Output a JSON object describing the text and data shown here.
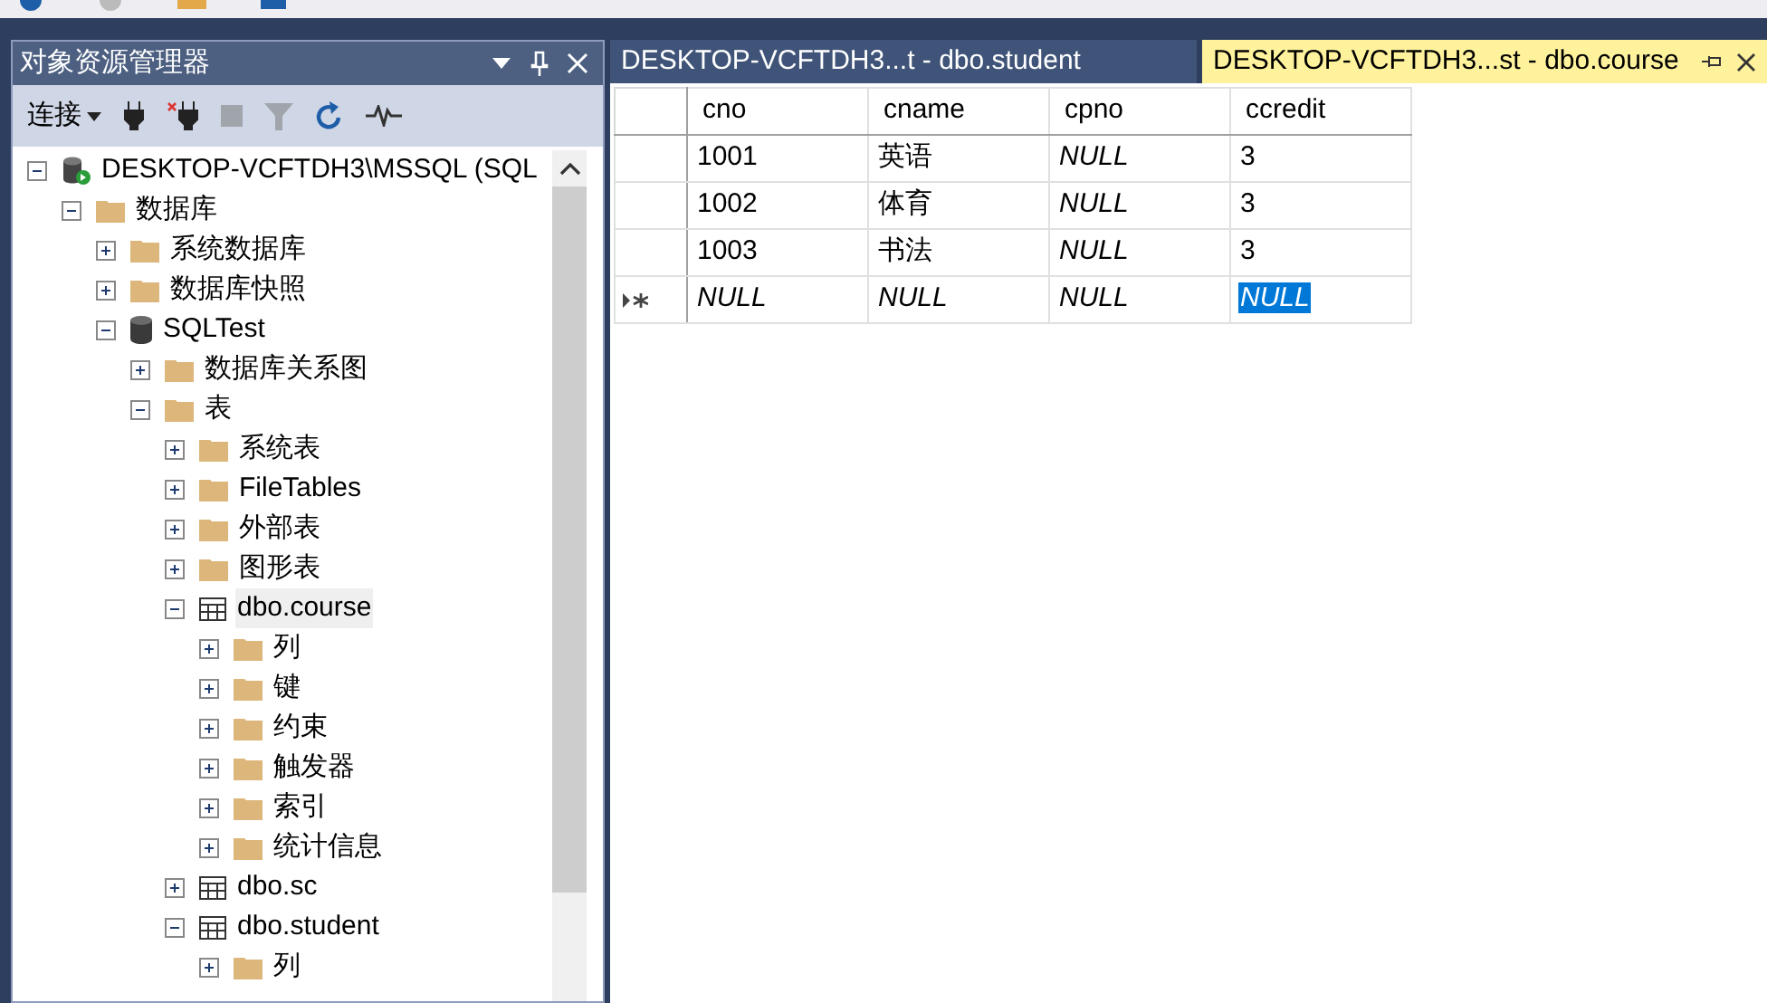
{
  "object_explorer": {
    "title": "对象资源管理器",
    "connect_label": "连接",
    "tree": [
      {
        "label": "DESKTOP-VCFTDH3\\MSSQL (SQL",
        "kind": "server",
        "expanded": true,
        "selected": false,
        "children": [
          {
            "label": "数据库",
            "kind": "folder",
            "expanded": true,
            "selected": false,
            "children": [
              {
                "label": "系统数据库",
                "kind": "folder",
                "expanded": false,
                "selected": false
              },
              {
                "label": "数据库快照",
                "kind": "folder",
                "expanded": false,
                "selected": false
              },
              {
                "label": "SQLTest",
                "kind": "database",
                "expanded": true,
                "selected": false,
                "children": [
                  {
                    "label": "数据库关系图",
                    "kind": "folder",
                    "expanded": false,
                    "selected": false
                  },
                  {
                    "label": "表",
                    "kind": "folder",
                    "expanded": true,
                    "selected": false,
                    "children": [
                      {
                        "label": "系统表",
                        "kind": "folder",
                        "expanded": false,
                        "selected": false
                      },
                      {
                        "label": "FileTables",
                        "kind": "folder",
                        "expanded": false,
                        "selected": false
                      },
                      {
                        "label": "外部表",
                        "kind": "folder",
                        "expanded": false,
                        "selected": false
                      },
                      {
                        "label": "图形表",
                        "kind": "folder",
                        "expanded": false,
                        "selected": false
                      },
                      {
                        "label": "dbo.course",
                        "kind": "table",
                        "expanded": true,
                        "selected": true,
                        "children": [
                          {
                            "label": "列",
                            "kind": "folder",
                            "expanded": false,
                            "selected": false
                          },
                          {
                            "label": "键",
                            "kind": "folder",
                            "expanded": false,
                            "selected": false
                          },
                          {
                            "label": "约束",
                            "kind": "folder",
                            "expanded": false,
                            "selected": false
                          },
                          {
                            "label": "触发器",
                            "kind": "folder",
                            "expanded": false,
                            "selected": false
                          },
                          {
                            "label": "索引",
                            "kind": "folder",
                            "expanded": false,
                            "selected": false
                          },
                          {
                            "label": "统计信息",
                            "kind": "folder",
                            "expanded": false,
                            "selected": false
                          }
                        ]
                      },
                      {
                        "label": "dbo.sc",
                        "kind": "table",
                        "expanded": false,
                        "selected": false
                      },
                      {
                        "label": "dbo.student",
                        "kind": "table",
                        "expanded": true,
                        "selected": false,
                        "children": [
                          {
                            "label": "列",
                            "kind": "folder",
                            "expanded": false,
                            "selected": false
                          }
                        ]
                      }
                    ]
                  }
                ]
              }
            ]
          }
        ]
      }
    ]
  },
  "tabs": [
    {
      "label": "DESKTOP-VCFTDH3...t - dbo.student",
      "selected": false
    },
    {
      "label": "DESKTOP-VCFTDH3...st - dbo.course",
      "selected": true
    }
  ],
  "grid": {
    "columns": [
      "cno",
      "cname",
      "cpno",
      "ccredit"
    ],
    "rows": [
      {
        "new_row": false,
        "cells": [
          {
            "value": "1001",
            "is_null": false,
            "selected": false
          },
          {
            "value": "英语",
            "is_null": false,
            "selected": false
          },
          {
            "value": "NULL",
            "is_null": true,
            "selected": false
          },
          {
            "value": "3",
            "is_null": false,
            "selected": false
          }
        ]
      },
      {
        "new_row": false,
        "cells": [
          {
            "value": "1002",
            "is_null": false,
            "selected": false
          },
          {
            "value": "体育",
            "is_null": false,
            "selected": false
          },
          {
            "value": "NULL",
            "is_null": true,
            "selected": false
          },
          {
            "value": "3",
            "is_null": false,
            "selected": false
          }
        ]
      },
      {
        "new_row": false,
        "cells": [
          {
            "value": "1003",
            "is_null": false,
            "selected": false
          },
          {
            "value": "书法",
            "is_null": false,
            "selected": false
          },
          {
            "value": "NULL",
            "is_null": true,
            "selected": false
          },
          {
            "value": "3",
            "is_null": false,
            "selected": false
          }
        ]
      },
      {
        "new_row": true,
        "cells": [
          {
            "value": "NULL",
            "is_null": true,
            "selected": false
          },
          {
            "value": "NULL",
            "is_null": true,
            "selected": false
          },
          {
            "value": "NULL",
            "is_null": true,
            "selected": false
          },
          {
            "value": "NULL",
            "is_null": true,
            "selected": true
          }
        ]
      }
    ]
  }
}
